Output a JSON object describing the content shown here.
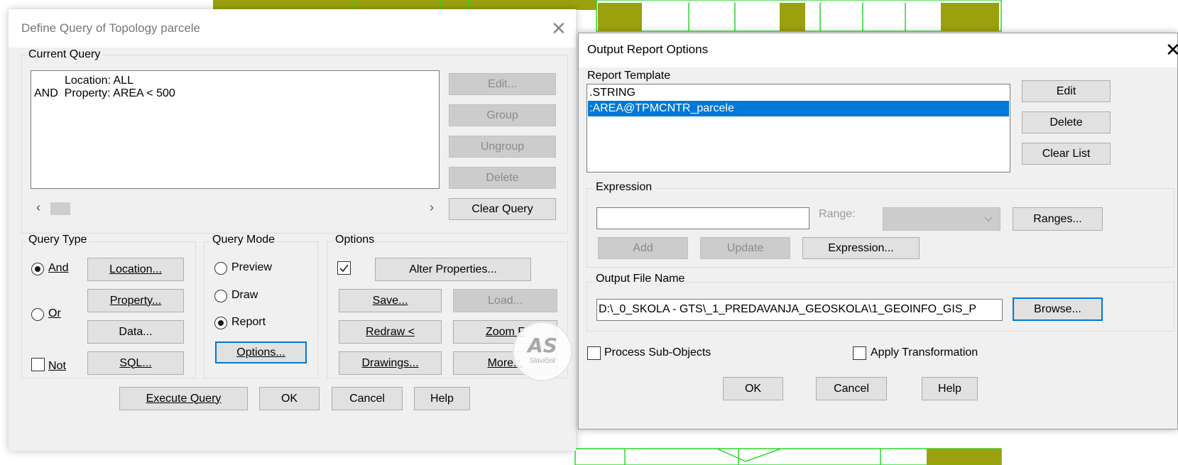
{
  "query_dialog": {
    "title": "Define Query of Topology parcele",
    "close_icon": "close-icon",
    "current_query": {
      "label": "Current Query",
      "lines": [
        "Location: ALL",
        "AND  Property: AREA < 500"
      ]
    },
    "side_buttons": {
      "edit": "Edit...",
      "group": "Group",
      "ungroup": "Ungroup",
      "delete": "Delete",
      "clear_query": "Clear Query"
    },
    "query_type": {
      "label": "Query Type",
      "and": "And",
      "or": "Or",
      "not": "Not",
      "selected": "And",
      "not_checked": false,
      "location": "Location...",
      "property": "Property...",
      "data": "Data...",
      "sql": "SQL..."
    },
    "query_mode": {
      "label": "Query Mode",
      "preview": "Preview",
      "draw": "Draw",
      "report": "Report",
      "selected": "Report",
      "options": "Options..."
    },
    "options": {
      "label": "Options",
      "alter_checked": true,
      "alter_properties": "Alter Properties...",
      "save": "Save...",
      "load": "Load...",
      "redraw": "Redraw <",
      "zoom": "Zoom F",
      "drawings": "Drawings...",
      "more": "More..."
    },
    "footer": {
      "execute": "Execute Query",
      "ok": "OK",
      "cancel": "Cancel",
      "help": "Help"
    }
  },
  "report_dialog": {
    "title": "Output Report Options",
    "close_icon": "close-icon",
    "template_label": "Report Template",
    "templates": [
      ".STRING",
      ":AREA@TPMCNTR_parcele"
    ],
    "selected_index": 1,
    "edit": "Edit",
    "delete": "Delete",
    "clear_list": "Clear List",
    "expression": {
      "label": "Expression",
      "value": "",
      "range_label": "Range:",
      "ranges": "Ranges...",
      "add": "Add",
      "update": "Update",
      "expression_btn": "Expression..."
    },
    "output": {
      "label": "Output File Name",
      "value": "D:\\_0_SKOLA - GTS\\_1_PREDAVANJA_GEOSKOLA\\1_GEOINFO_GIS_P",
      "browse": "Browse..."
    },
    "process_sub_objects": "Process Sub-Objects",
    "apply_transformation": "Apply Transformation",
    "ok": "OK",
    "cancel": "Cancel",
    "help": "Help"
  },
  "watermark": {
    "logo": "AS",
    "name": "Slaviček"
  },
  "colors": {
    "parcel_fill": "#9aa00e",
    "parcel_line": "#2bd62b",
    "selection": "#0078d7"
  }
}
